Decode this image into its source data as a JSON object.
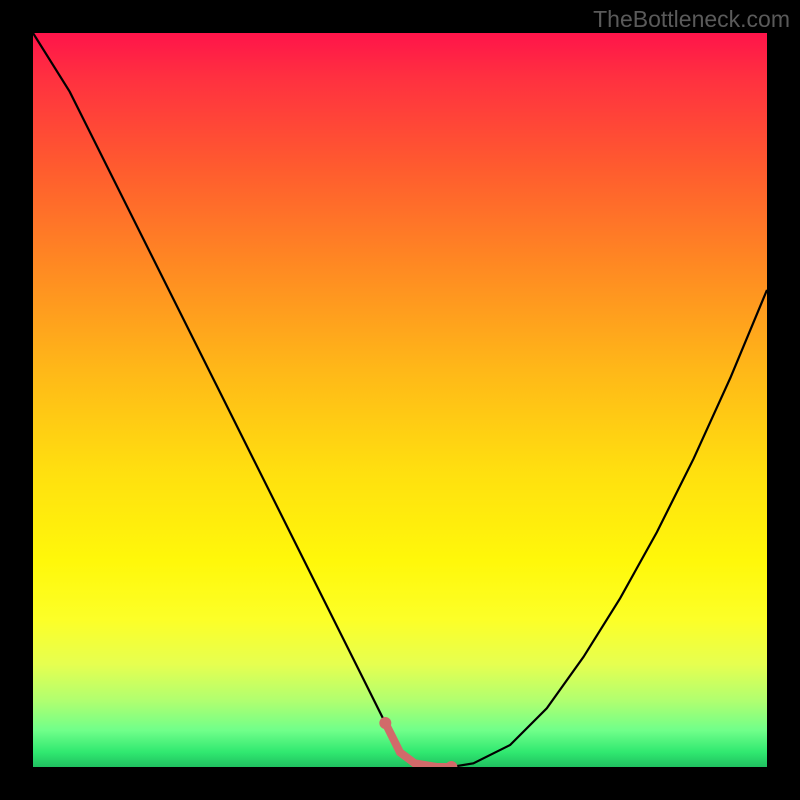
{
  "watermark": "TheBottleneck.com",
  "chart_data": {
    "type": "line",
    "title": "",
    "xlabel": "",
    "ylabel": "",
    "xlim": [
      0,
      100
    ],
    "ylim": [
      0,
      100
    ],
    "x": [
      0,
      5,
      10,
      15,
      20,
      25,
      30,
      35,
      40,
      45,
      48,
      50,
      52,
      55,
      57,
      60,
      65,
      70,
      75,
      80,
      85,
      90,
      95,
      100
    ],
    "values": [
      100,
      92,
      82,
      72,
      62,
      52,
      42,
      32,
      22,
      12,
      6,
      2,
      0.5,
      0,
      0,
      0.5,
      3,
      8,
      15,
      23,
      32,
      42,
      53,
      65
    ],
    "marker_region": {
      "x_start": 48,
      "x_end": 58,
      "color": "#d16a6a"
    },
    "curve_color": "#000000"
  }
}
